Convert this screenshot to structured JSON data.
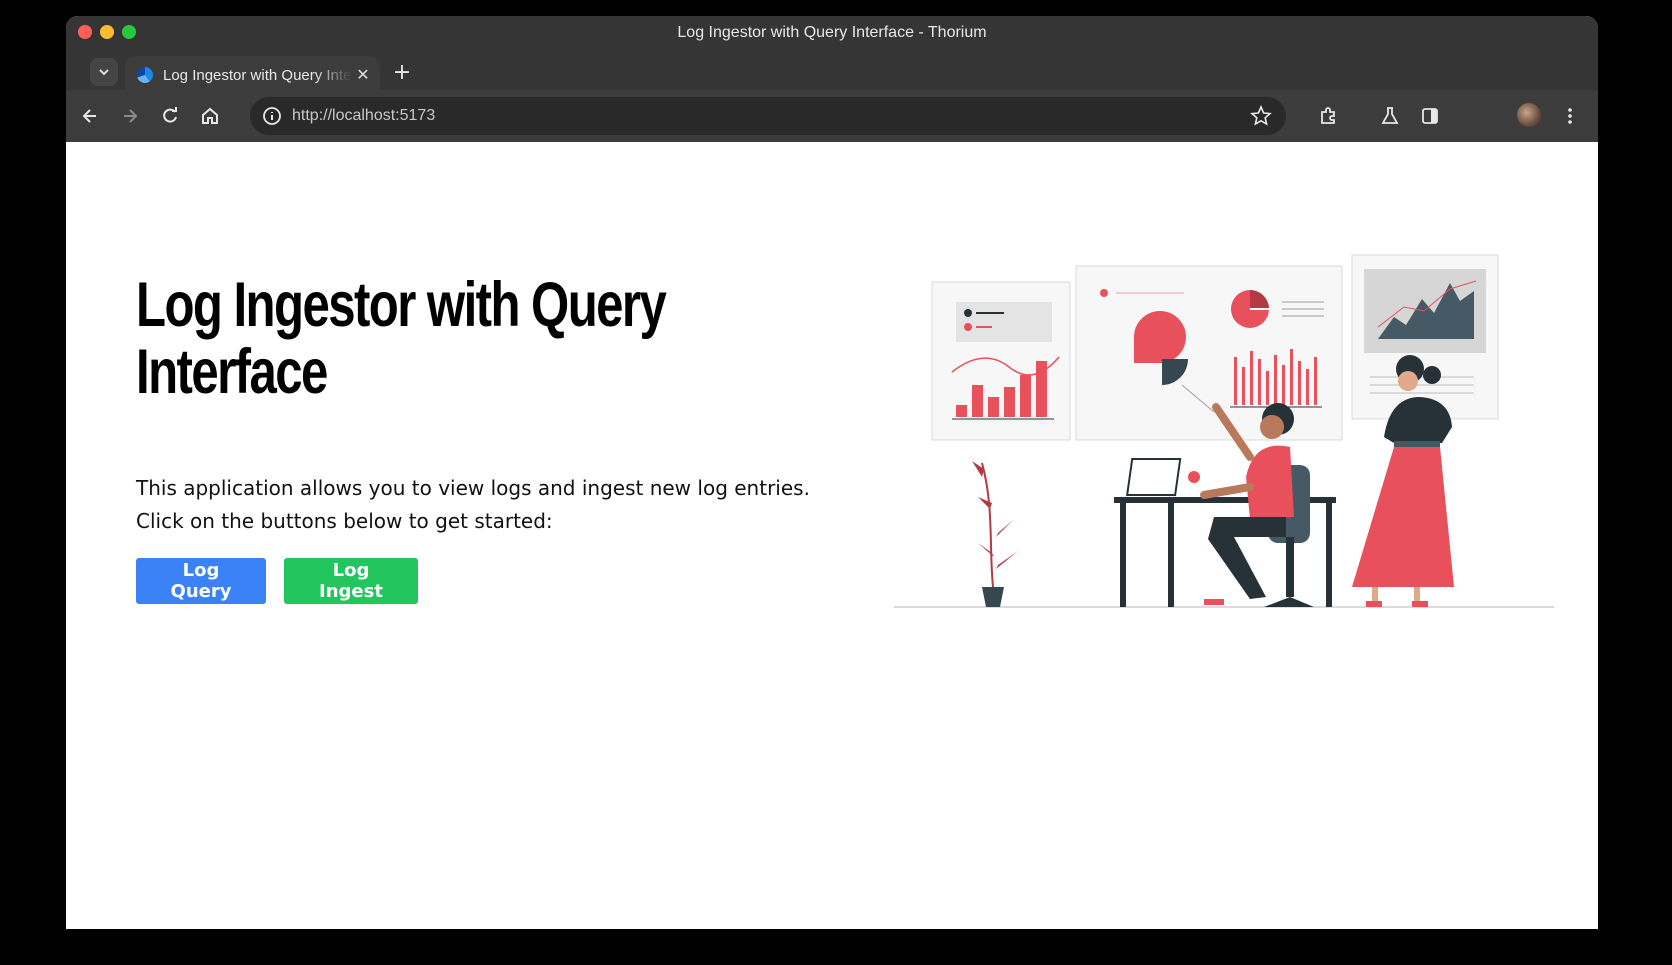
{
  "window": {
    "title": "Log Ingestor with Query Interface - Thorium"
  },
  "tabs": [
    {
      "label": "Log Ingestor with Query Interface",
      "close_icon": "close-icon"
    }
  ],
  "toolbar": {
    "url": "http://localhost:5173"
  },
  "page": {
    "heading": "Log Ingestor with Query Interface",
    "description_line1": "This application allows you to view logs and ingest new log entries.",
    "description_line2": "Click on the buttons below to get started:",
    "buttons": {
      "query": "Log Query",
      "ingest": "Log Ingest"
    }
  },
  "colors": {
    "query_button": "#3b82f6",
    "ingest_button": "#22c55e",
    "illustration_accent": "#e8505b",
    "illustration_dark": "#263238"
  }
}
